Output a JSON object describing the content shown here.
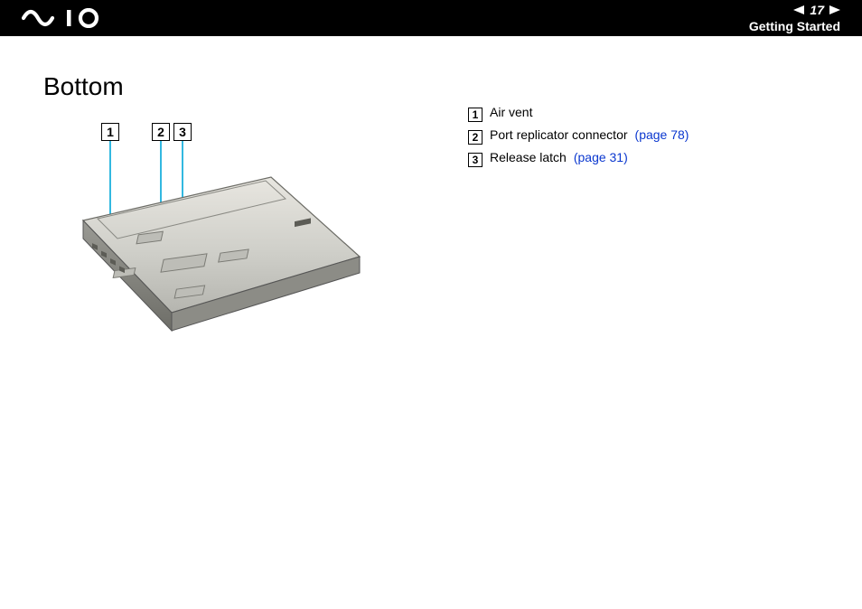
{
  "header": {
    "page_number": "17",
    "section": "Getting Started"
  },
  "page": {
    "title": "Bottom"
  },
  "diagram": {
    "callouts": [
      "1",
      "2",
      "3"
    ]
  },
  "legend": [
    {
      "num": "1",
      "label": "Air vent",
      "link": ""
    },
    {
      "num": "2",
      "label": "Port replicator connector",
      "link": "(page 78)"
    },
    {
      "num": "3",
      "label": "Release latch",
      "link": "(page 31)"
    }
  ]
}
